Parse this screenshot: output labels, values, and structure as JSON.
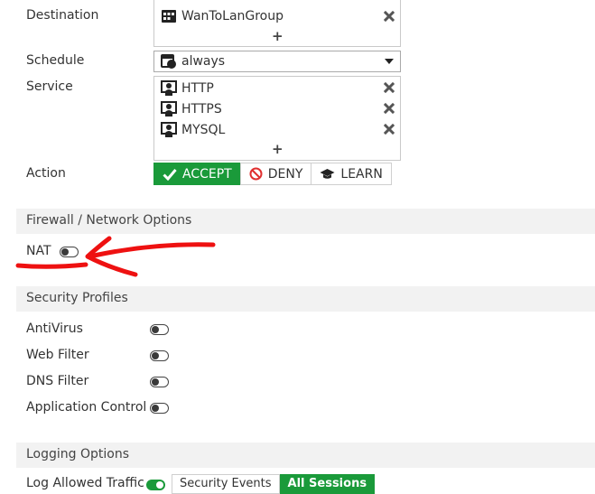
{
  "policy": {
    "destination": {
      "label": "Destination",
      "items": [
        {
          "name": "WanToLanGroup",
          "icon": "address-group-icon"
        }
      ],
      "add": "+"
    },
    "schedule": {
      "label": "Schedule",
      "value": "always",
      "icon": "schedule-icon"
    },
    "service": {
      "label": "Service",
      "items": [
        {
          "name": "HTTP",
          "icon": "service-icon"
        },
        {
          "name": "HTTPS",
          "icon": "service-icon"
        },
        {
          "name": "MYSQL",
          "icon": "service-icon"
        }
      ],
      "add": "+"
    },
    "action": {
      "label": "Action",
      "options": [
        "ACCEPT",
        "DENY",
        "LEARN"
      ],
      "selected": "ACCEPT"
    }
  },
  "firewall": {
    "title": "Firewall / Network Options",
    "nat": {
      "label": "NAT",
      "enabled": false
    }
  },
  "security": {
    "title": "Security Profiles",
    "items": [
      {
        "label": "AntiVirus",
        "enabled": false
      },
      {
        "label": "Web Filter",
        "enabled": false
      },
      {
        "label": "DNS Filter",
        "enabled": false
      },
      {
        "label": "Application Control",
        "enabled": false
      }
    ]
  },
  "logging": {
    "title": "Logging Options",
    "allowed_traffic": {
      "label": "Log Allowed Traffic",
      "enabled": true,
      "options": [
        "Security Events",
        "All Sessions"
      ],
      "selected": "All Sessions"
    }
  },
  "colors": {
    "accent": "#1a9a3a",
    "annotation": "#ee1111",
    "section_bg": "#f2f2f2",
    "deny": "#e03030"
  }
}
